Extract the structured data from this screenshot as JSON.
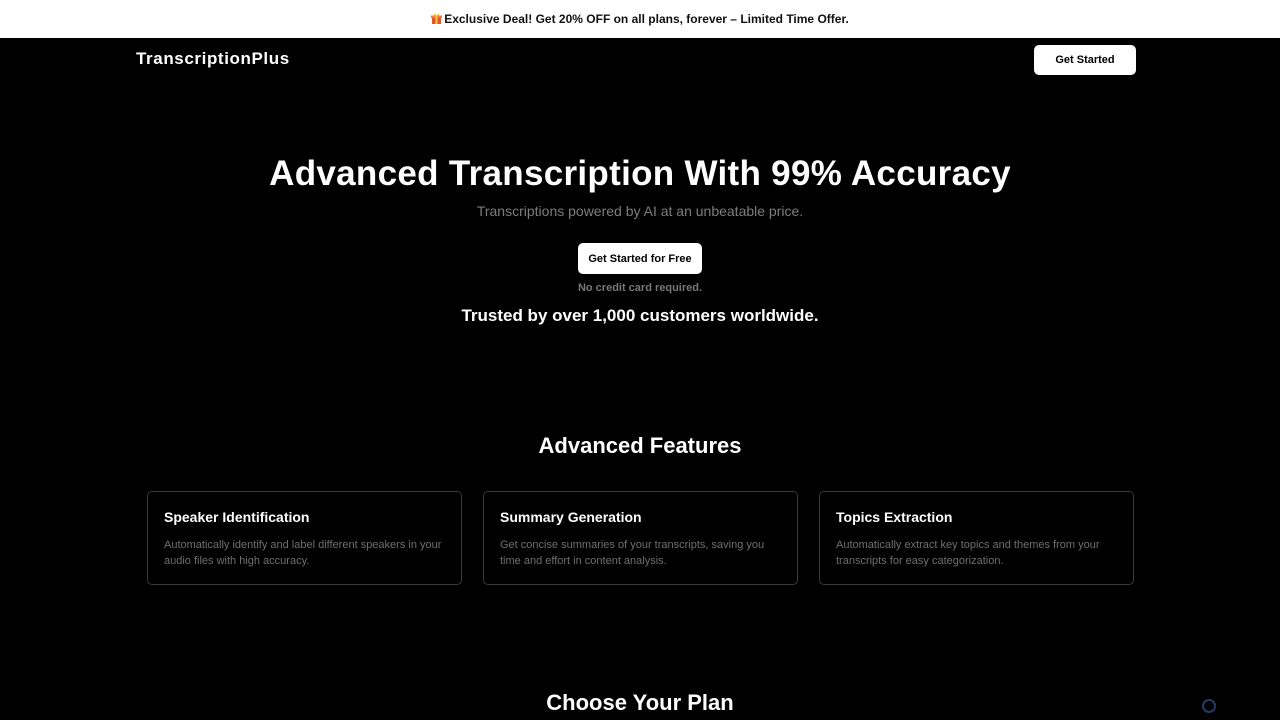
{
  "promo": {
    "icon": "gift-icon",
    "text": "Exclusive Deal! Get 20% OFF on all plans, forever – Limited Time Offer."
  },
  "nav": {
    "brand": "TranscriptionPlus",
    "cta_label": "Get Started"
  },
  "hero": {
    "title": "Advanced Transcription With 99% Accuracy",
    "subtitle": "Transcriptions powered by AI at an unbeatable price.",
    "cta_label": "Get Started for Free",
    "note": "No credit card required.",
    "trusted": "Trusted by over 1,000 customers worldwide."
  },
  "features": {
    "title": "Advanced Features",
    "items": [
      {
        "title": "Speaker Identification",
        "description": "Automatically identify and label different speakers in your audio files with high accuracy."
      },
      {
        "title": "Summary Generation",
        "description": "Get concise summaries of your transcripts, saving you time and effort in content analysis."
      },
      {
        "title": "Topics Extraction",
        "description": "Automatically extract key topics and themes from your transcripts for easy categorization."
      }
    ]
  },
  "plans": {
    "title": "Choose Your Plan"
  },
  "colors": {
    "background": "#000000",
    "promo_bg": "#ffffff",
    "muted_text": "#7d7d7d",
    "card_border": "#3a3a3a"
  }
}
